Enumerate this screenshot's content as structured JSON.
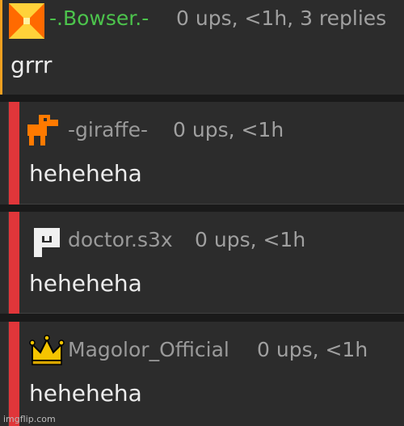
{
  "comments": [
    {
      "username": "-.Bowser.-",
      "username_color": "#4cc34c",
      "meta": "0 ups, <1h, 3 replies",
      "text": "grrr",
      "avatar_icon": "orange-pinwheel-icon"
    },
    {
      "username": "-giraffe-",
      "username_color": "#9a9a9a",
      "meta": "0 ups, <1h",
      "text": "heheheha",
      "avatar_icon": "orange-giraffe-icon"
    },
    {
      "username": "doctor.s3x",
      "username_color": "#9a9a9a",
      "meta": "0 ups, <1h",
      "text": "heheheha",
      "avatar_icon": "white-square-glyph-icon"
    },
    {
      "username": "Magolor_Official",
      "username_color": "#9a9a9a",
      "meta": "0 ups, <1h",
      "text": "heheheha",
      "avatar_icon": "crown-icon"
    }
  ],
  "colors": {
    "background": "#1a1a1a",
    "card": "#2c2c2c",
    "reply_bar": "#e0363a",
    "top_accent": "#f0a020",
    "meta_text": "#a0a0a0"
  },
  "watermark": "imgflip.com"
}
